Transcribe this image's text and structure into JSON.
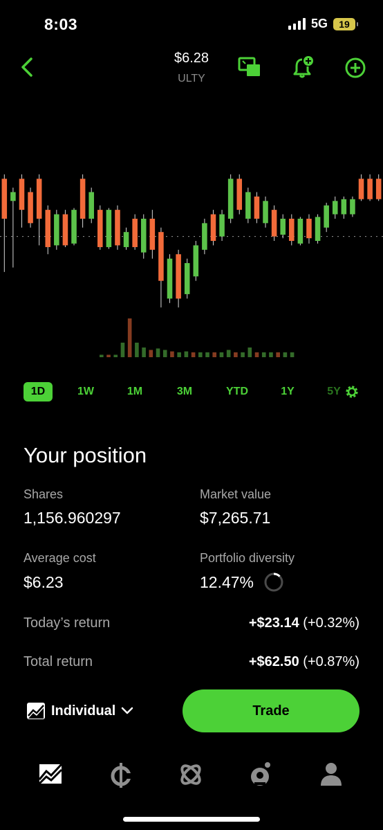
{
  "status": {
    "time": "8:03",
    "network": "5G",
    "battery": "19"
  },
  "header": {
    "price": "$6.28",
    "ticker": "ULTY"
  },
  "chart_data": {
    "type": "candlestick",
    "interval": "1D",
    "reference_line": "dotted",
    "candles": [
      {
        "dir": "down",
        "o": 6.345,
        "c": 6.3,
        "h": 6.35,
        "l": 6.24
      },
      {
        "dir": "up",
        "o": 6.32,
        "c": 6.33,
        "h": 6.335,
        "l": 6.245
      },
      {
        "dir": "down",
        "o": 6.345,
        "c": 6.31,
        "h": 6.35,
        "l": 6.29
      },
      {
        "dir": "down",
        "o": 6.33,
        "c": 6.295,
        "h": 6.335,
        "l": 6.29
      },
      {
        "dir": "down",
        "o": 6.345,
        "c": 6.3,
        "h": 6.35,
        "l": 6.27
      },
      {
        "dir": "down",
        "o": 6.31,
        "c": 6.268,
        "h": 6.315,
        "l": 6.26
      },
      {
        "dir": "up",
        "o": 6.27,
        "c": 6.305,
        "h": 6.31,
        "l": 6.265
      },
      {
        "dir": "down",
        "o": 6.305,
        "c": 6.27,
        "h": 6.31,
        "l": 6.268
      },
      {
        "dir": "up",
        "o": 6.272,
        "c": 6.31,
        "h": 6.312,
        "l": 6.27
      },
      {
        "dir": "down",
        "o": 6.345,
        "c": 6.3,
        "h": 6.35,
        "l": 6.29
      },
      {
        "dir": "up",
        "o": 6.3,
        "c": 6.33,
        "h": 6.335,
        "l": 6.295
      },
      {
        "dir": "down",
        "o": 6.31,
        "c": 6.268,
        "h": 6.315,
        "l": 6.265
      },
      {
        "dir": "up",
        "o": 6.268,
        "c": 6.31,
        "h": 6.312,
        "l": 6.266
      },
      {
        "dir": "down",
        "o": 6.31,
        "c": 6.27,
        "h": 6.315,
        "l": 6.265
      },
      {
        "dir": "up",
        "o": 6.268,
        "c": 6.285,
        "h": 6.29,
        "l": 6.265
      },
      {
        "dir": "down",
        "o": 6.3,
        "c": 6.268,
        "h": 6.305,
        "l": 6.265
      },
      {
        "dir": "up",
        "o": 6.262,
        "c": 6.3,
        "h": 6.305,
        "l": 6.255
      },
      {
        "dir": "down",
        "o": 6.3,
        "c": 6.265,
        "h": 6.31,
        "l": 6.255
      },
      {
        "dir": "down",
        "o": 6.285,
        "c": 6.23,
        "h": 6.29,
        "l": 6.2
      },
      {
        "dir": "up",
        "o": 6.21,
        "c": 6.255,
        "h": 6.26,
        "l": 6.205
      },
      {
        "dir": "down",
        "o": 6.26,
        "c": 6.21,
        "h": 6.265,
        "l": 6.2
      },
      {
        "dir": "up",
        "o": 6.215,
        "c": 6.25,
        "h": 6.255,
        "l": 6.21
      },
      {
        "dir": "up",
        "o": 6.235,
        "c": 6.27,
        "h": 6.275,
        "l": 6.23
      },
      {
        "dir": "up",
        "o": 6.265,
        "c": 6.295,
        "h": 6.3,
        "l": 6.26
      },
      {
        "dir": "down",
        "o": 6.305,
        "c": 6.275,
        "h": 6.31,
        "l": 6.27
      },
      {
        "dir": "up",
        "o": 6.28,
        "c": 6.305,
        "h": 6.31,
        "l": 6.275
      },
      {
        "dir": "up",
        "o": 6.3,
        "c": 6.345,
        "h": 6.35,
        "l": 6.295
      },
      {
        "dir": "down",
        "o": 6.345,
        "c": 6.31,
        "h": 6.35,
        "l": 6.305
      },
      {
        "dir": "up",
        "o": 6.3,
        "c": 6.33,
        "h": 6.335,
        "l": 6.295
      },
      {
        "dir": "down",
        "o": 6.325,
        "c": 6.3,
        "h": 6.33,
        "l": 6.295
      },
      {
        "dir": "up",
        "o": 6.295,
        "c": 6.32,
        "h": 6.325,
        "l": 6.29
      },
      {
        "dir": "down",
        "o": 6.31,
        "c": 6.28,
        "h": 6.315,
        "l": 6.275
      },
      {
        "dir": "up",
        "o": 6.282,
        "c": 6.3,
        "h": 6.305,
        "l": 6.278
      },
      {
        "dir": "down",
        "o": 6.3,
        "c": 6.275,
        "h": 6.305,
        "l": 6.27
      },
      {
        "dir": "up",
        "o": 6.272,
        "c": 6.3,
        "h": 6.302,
        "l": 6.27
      },
      {
        "dir": "down",
        "o": 6.3,
        "c": 6.278,
        "h": 6.305,
        "l": 6.272
      },
      {
        "dir": "up",
        "o": 6.275,
        "c": 6.302,
        "h": 6.305,
        "l": 6.272
      },
      {
        "dir": "up",
        "o": 6.29,
        "c": 6.315,
        "h": 6.318,
        "l": 6.285
      },
      {
        "dir": "up",
        "o": 6.305,
        "c": 6.32,
        "h": 6.325,
        "l": 6.3
      },
      {
        "dir": "up",
        "o": 6.305,
        "c": 6.322,
        "h": 6.325,
        "l": 6.3
      },
      {
        "dir": "up",
        "o": 6.305,
        "c": 6.322,
        "h": 6.325,
        "l": 6.302
      },
      {
        "dir": "down",
        "o": 6.345,
        "c": 6.322,
        "h": 6.35,
        "l": 6.32
      },
      {
        "dir": "down",
        "o": 6.345,
        "c": 6.322,
        "h": 6.35,
        "l": 6.32
      },
      {
        "dir": "down",
        "o": 6.345,
        "c": 6.322,
        "h": 6.35,
        "l": 6.32
      }
    ],
    "volume_levels": [
      0.05,
      0.05,
      0.05,
      0.3,
      0.8,
      0.3,
      0.2,
      0.15,
      0.18,
      0.15,
      0.12,
      0.1,
      0.12,
      0.1,
      0.1,
      0.1,
      0.1,
      0.1,
      0.15,
      0.1,
      0.1,
      0.2,
      0.1,
      0.1,
      0.1,
      0.1,
      0.1,
      0.1
    ]
  },
  "ranges": [
    "1D",
    "1W",
    "1M",
    "3M",
    "YTD",
    "1Y",
    "5Y"
  ],
  "active_range": "1D",
  "position": {
    "title": "Your position",
    "shares_label": "Shares",
    "shares_value": "1,156.960297",
    "market_value_label": "Market value",
    "market_value": "$7,265.71",
    "avg_cost_label": "Average cost",
    "avg_cost": "$6.23",
    "diversity_label": "Portfolio diversity",
    "diversity": "12.47%",
    "diversity_fraction": 0.1247,
    "today_label": "Today’s return",
    "today_amount": "+$23.14",
    "today_pct": "(+0.32%)",
    "total_label": "Total return",
    "total_amount": "+$62.50",
    "total_pct": "(+0.87%)"
  },
  "account": {
    "label": "Individual"
  },
  "trade_label": "Trade",
  "colors": {
    "accent": "#4cd137",
    "down": "#f26b3a",
    "up": "#5cc34a"
  },
  "tabs": [
    "home-icon",
    "crypto-icon",
    "network-icon",
    "browse-icon",
    "account-icon"
  ]
}
